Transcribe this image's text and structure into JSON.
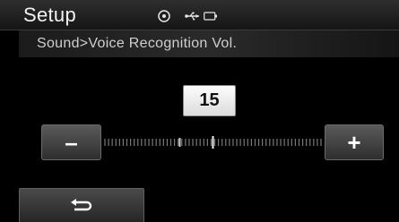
{
  "header": {
    "title": "Setup",
    "status_icons": [
      "disc-icon",
      "usb-icon",
      "battery-icon"
    ]
  },
  "breadcrumb": "Sound>Voice Recognition Vol.",
  "volume": {
    "value": "15",
    "level_fraction": 0.5,
    "minus_label": "–",
    "plus_label": "+"
  },
  "footer": {
    "back_icon": "back-arrow-icon"
  },
  "colors": {
    "background": "#000000",
    "text": "#f2f2f2",
    "value_box": "#f0f0f0"
  }
}
